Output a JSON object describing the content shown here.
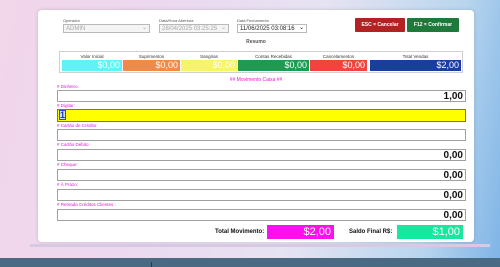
{
  "header": {
    "operador": {
      "label": "Operador",
      "value": "ADMIN"
    },
    "abertura": {
      "label": "Data/Hora Abertura",
      "value": "28/04/2025 03:25:25"
    },
    "fechamento": {
      "label": "Data Fechamento",
      "value": "11/06/2025 03:08:16"
    }
  },
  "buttons": {
    "cancel": "ESC = Cancelar",
    "confirm": "F12 = Confirmar"
  },
  "resumo": {
    "title": "Resumo",
    "columns": [
      {
        "label": "Valor Inicial",
        "value": "$0,00",
        "color": "#5ff2f8"
      },
      {
        "label": "Suprimentos",
        "value": "$0,00",
        "color": "#f08a48"
      },
      {
        "label": "Sangrias",
        "value": "$0,00",
        "color": "#f6f46a"
      },
      {
        "label": "Contas Recebidas",
        "value": "$0,00",
        "color": "#1f9a52"
      },
      {
        "label": "Cancelamentos",
        "value": "$0,00",
        "color": "#f0443c"
      },
      {
        "label": "Total Vendas",
        "value": "$2,00",
        "color": "#173f9c"
      }
    ]
  },
  "movimento": {
    "title": "## Movimento Caixa ##",
    "rows": [
      {
        "label": "# Dinheiro:",
        "value": "1,00"
      },
      {
        "label": "# Digitar:",
        "value": "1"
      },
      {
        "label": "# Cartão de Crédito:",
        "value": ""
      },
      {
        "label": "# Cartão Débito:",
        "value": "0,00"
      },
      {
        "label": "# Cheque:",
        "value": "0,00"
      },
      {
        "label": "# À Prazo:",
        "value": "0,00"
      },
      {
        "label": "# Retirada Créditos Clientes :",
        "value": "0,00"
      }
    ]
  },
  "totals": {
    "movimento_label": "Total Movimento:",
    "movimento_value": "$2,00",
    "saldo_label": "Saldo  Final R$:",
    "saldo_value": "$1,00"
  }
}
